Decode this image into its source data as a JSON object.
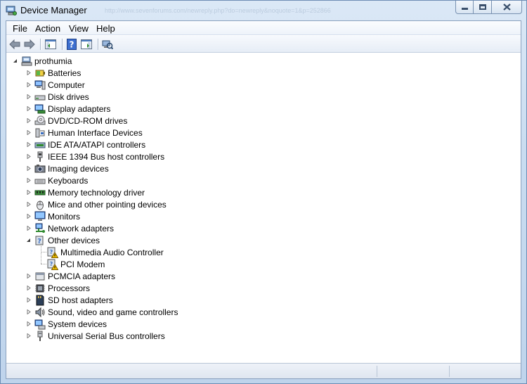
{
  "window": {
    "title": "Device Manager",
    "ghost_text": "http://www.sevenforums.com/newreply.php?do=newreply&noquote=1&p=252866"
  },
  "menu": [
    "File",
    "Action",
    "View",
    "Help"
  ],
  "toolbar": {
    "buttons": [
      "back-arrow-icon",
      "forward-arrow-icon",
      "show-hide-console-tree-icon",
      "help-icon",
      "properties-pane-icon",
      "scan-hardware-icon"
    ]
  },
  "tree": {
    "root": "prothumia",
    "items": [
      {
        "label": "Batteries",
        "icon": "battery-icon",
        "expanded": false
      },
      {
        "label": "Computer",
        "icon": "computer-icon",
        "expanded": false
      },
      {
        "label": "Disk drives",
        "icon": "disk-drive-icon",
        "expanded": false
      },
      {
        "label": "Display adapters",
        "icon": "display-adapter-icon",
        "expanded": false
      },
      {
        "label": "DVD/CD-ROM drives",
        "icon": "dvd-drive-icon",
        "expanded": false
      },
      {
        "label": "Human Interface Devices",
        "icon": "hid-icon",
        "expanded": false
      },
      {
        "label": "IDE ATA/ATAPI controllers",
        "icon": "ide-controller-icon",
        "expanded": false
      },
      {
        "label": "IEEE 1394 Bus host controllers",
        "icon": "firewire-icon",
        "expanded": false
      },
      {
        "label": "Imaging devices",
        "icon": "camera-icon",
        "expanded": false
      },
      {
        "label": "Keyboards",
        "icon": "keyboard-icon",
        "expanded": false
      },
      {
        "label": "Memory technology driver",
        "icon": "memory-icon",
        "expanded": false
      },
      {
        "label": "Mice and other pointing devices",
        "icon": "mouse-icon",
        "expanded": false
      },
      {
        "label": "Monitors",
        "icon": "monitor-icon",
        "expanded": false
      },
      {
        "label": "Network adapters",
        "icon": "network-adapter-icon",
        "expanded": false
      },
      {
        "label": "Other devices",
        "icon": "unknown-device-icon",
        "expanded": true,
        "children": [
          {
            "label": "Multimedia Audio Controller",
            "icon": "warning-device-icon"
          },
          {
            "label": "PCI Modem",
            "icon": "warning-device-icon"
          }
        ]
      },
      {
        "label": "PCMCIA adapters",
        "icon": "pcmcia-icon",
        "expanded": false
      },
      {
        "label": "Processors",
        "icon": "processor-icon",
        "expanded": false
      },
      {
        "label": "SD host adapters",
        "icon": "sd-card-icon",
        "expanded": false
      },
      {
        "label": "Sound, video and game controllers",
        "icon": "speaker-icon",
        "expanded": false
      },
      {
        "label": "System devices",
        "icon": "system-device-icon",
        "expanded": false
      },
      {
        "label": "Universal Serial Bus controllers",
        "icon": "usb-icon",
        "expanded": false
      }
    ]
  },
  "colors": {
    "accent": "#3a7fd5",
    "warning": "#f5c400"
  }
}
